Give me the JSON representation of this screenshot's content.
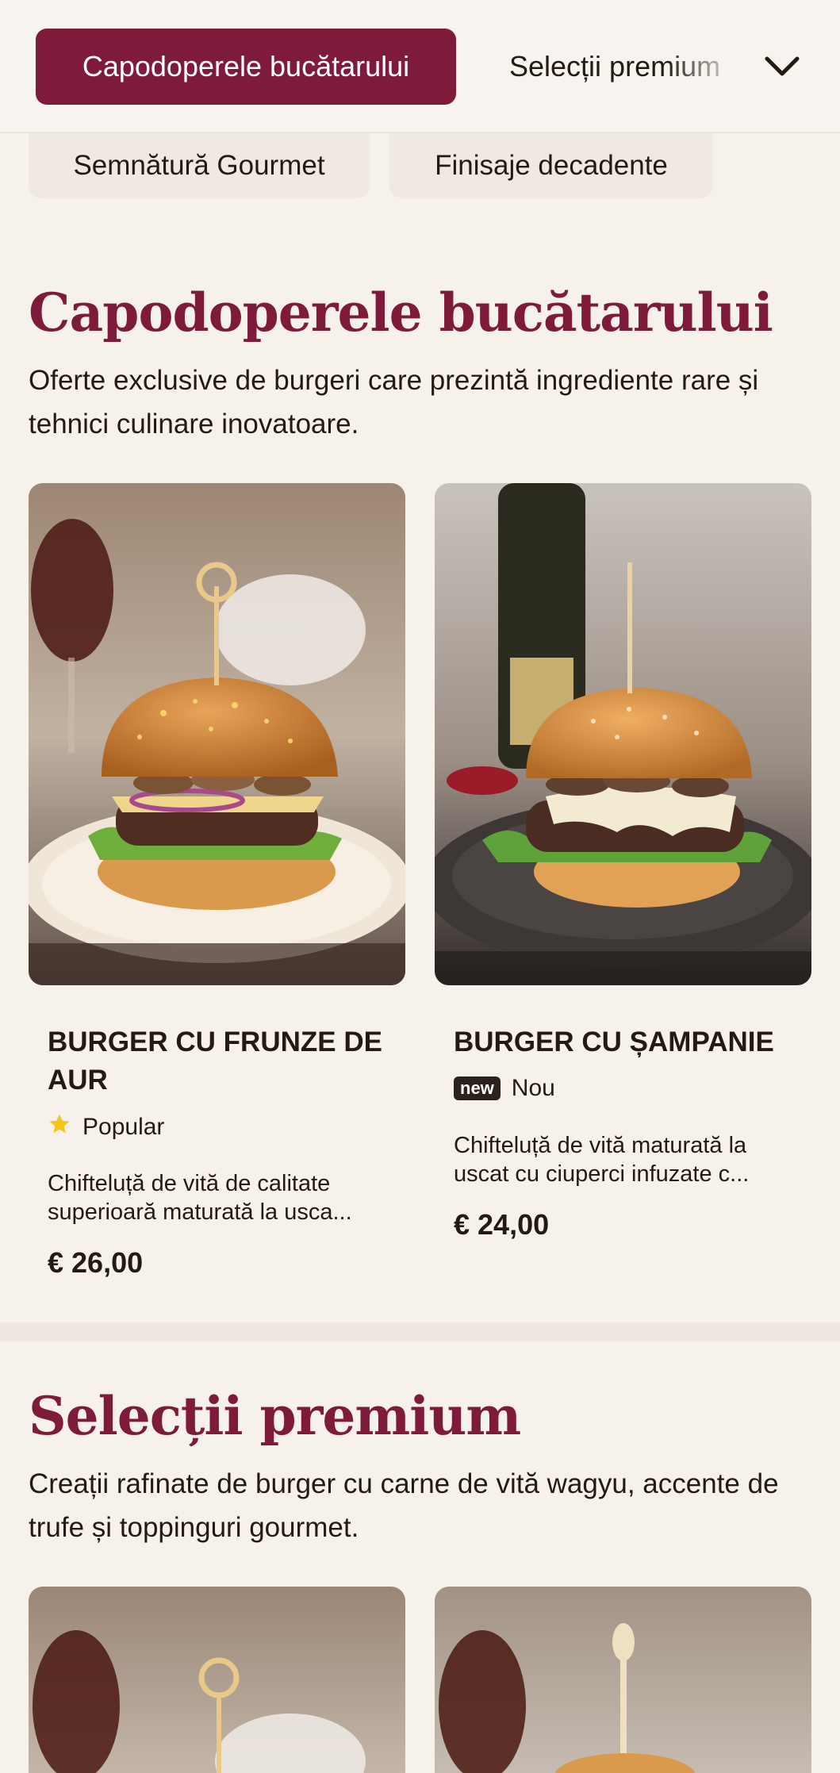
{
  "nav": {
    "tabs": [
      {
        "label": "Capodoperele bucătarului",
        "active": true
      },
      {
        "label": "Selecții premium",
        "active": false
      }
    ],
    "expand_icon": "chevron-down-icon"
  },
  "filters": [
    "Semnătură Gourmet",
    "Finisaje decadente"
  ],
  "sections": [
    {
      "title": "Capodoperele bucătarului",
      "description": "Oferte exclusive de burgeri care prezintă ingrediente rare și tehnici culinare inovatoare.",
      "items": [
        {
          "name": "Burger cu frunze de aur",
          "badge_icon": "star-icon",
          "badge_text": "Popular",
          "description": "Chifteluță de vită de calitate superioară maturată la usca...",
          "price": "€ 26,00"
        },
        {
          "name": "Burger cu șampanie",
          "badge_icon": "new",
          "badge_text": "Nou",
          "description": "Chifteluță de vită maturată la uscat cu ciuperci infuzate c...",
          "price": "€ 24,00"
        }
      ]
    },
    {
      "title": "Selecții premium",
      "description": "Creații rafinate de burger cu carne de vită wagyu, accente de trufe și toppinguri gourmet."
    }
  ],
  "colors": {
    "accent": "#7e1a3a",
    "background": "#f6f1ea",
    "star": "#f5c518"
  }
}
